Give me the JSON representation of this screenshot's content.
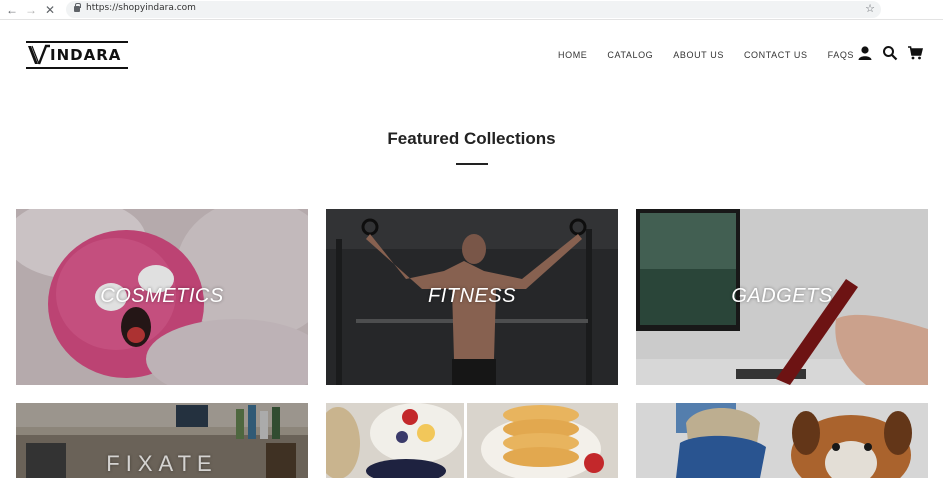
{
  "browser": {
    "url": "https://shopyindara.com"
  },
  "header": {
    "logo_text": "INDARA",
    "nav": [
      {
        "label": "HOME"
      },
      {
        "label": "CATALOG"
      },
      {
        "label": "ABOUT US"
      },
      {
        "label": "CONTACT US"
      },
      {
        "label": "FAQS"
      }
    ],
    "icons": [
      "account-icon",
      "search-icon",
      "cart-icon"
    ]
  },
  "featured": {
    "title": "Featured Collections",
    "collections": [
      {
        "label": "COSMETICS"
      },
      {
        "label": "FITNESS"
      },
      {
        "label": "GADGETS"
      },
      {
        "label": "FIXATE"
      },
      {
        "label": ""
      },
      {
        "label": ""
      }
    ]
  }
}
